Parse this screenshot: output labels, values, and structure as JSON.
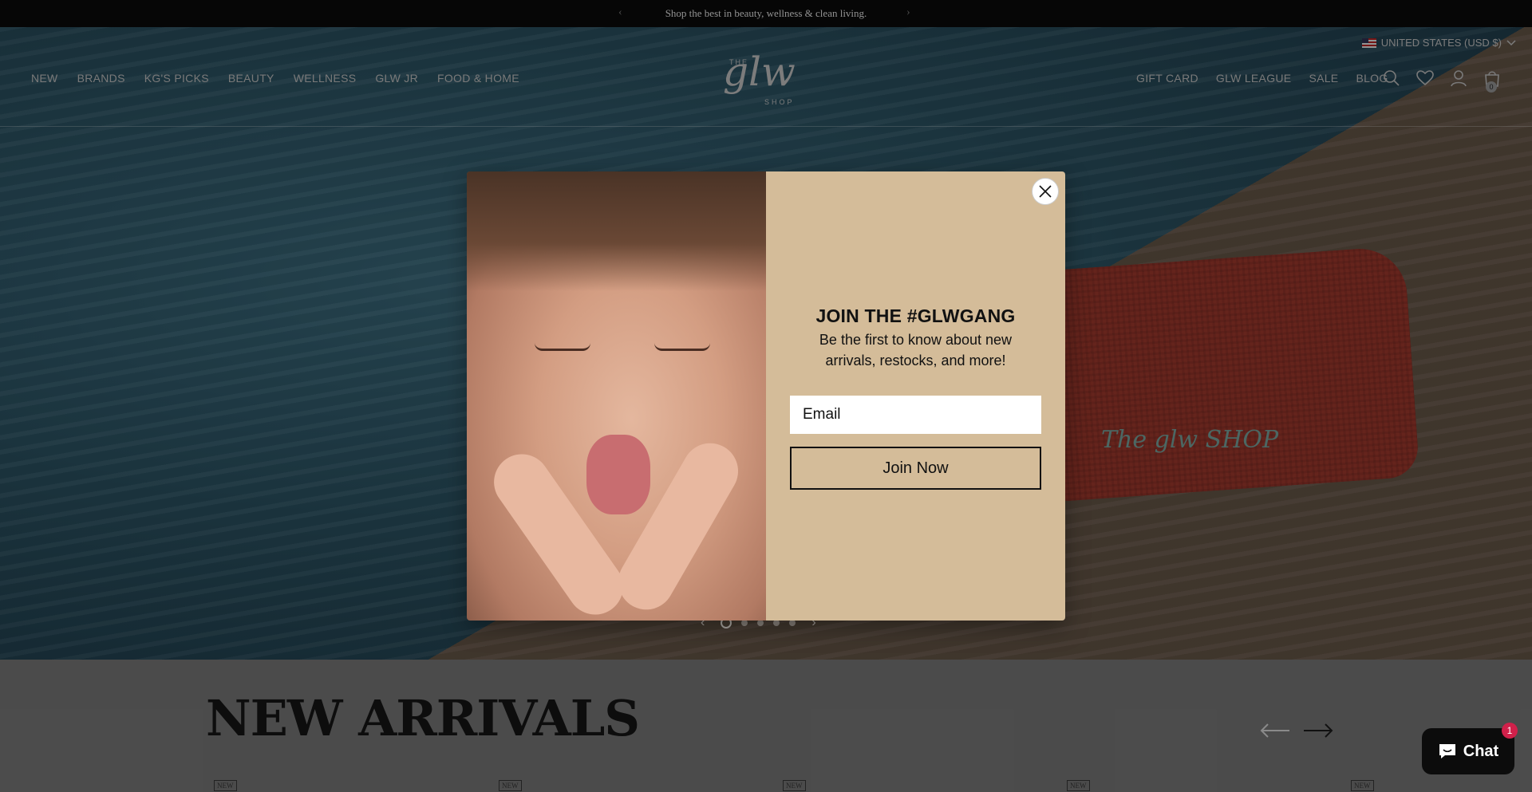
{
  "announcement": {
    "text": "Shop the best in beauty, wellness & clean living.",
    "prev": "‹",
    "next": "›"
  },
  "header": {
    "country": "UNITED STATES (USD $)",
    "logo": {
      "the": "THE",
      "script": "glw",
      "shop": "SHOP"
    },
    "nav_left": [
      "NEW",
      "BRANDS",
      "KG'S PICKS",
      "BEAUTY",
      "WELLNESS",
      "GLW JR",
      "FOOD & HOME"
    ],
    "nav_right": [
      "GIFT CARD",
      "GLW LEAGUE",
      "SALE",
      "BLOG"
    ],
    "cart_count": "0",
    "icons": [
      "search-icon",
      "heart-icon",
      "account-icon",
      "bag-icon"
    ]
  },
  "hero": {
    "slides_total": 5,
    "active_slide": 1,
    "pouch_logo": "The glw SHOP"
  },
  "modal": {
    "title": "JOIN THE #GLWGANG",
    "subtitle": "Be the first to know about new arrivals, restocks, and more!",
    "email_placeholder": "Email",
    "button": "Join Now"
  },
  "section": {
    "title": "NEW ARRIVALS",
    "badge": "NEW"
  },
  "chat": {
    "label": "Chat",
    "unread": "1"
  },
  "colors": {
    "modal_bg": "#d4bc99",
    "announcement_bg": "#0b0b0b",
    "chat_badge": "#d0204a"
  }
}
